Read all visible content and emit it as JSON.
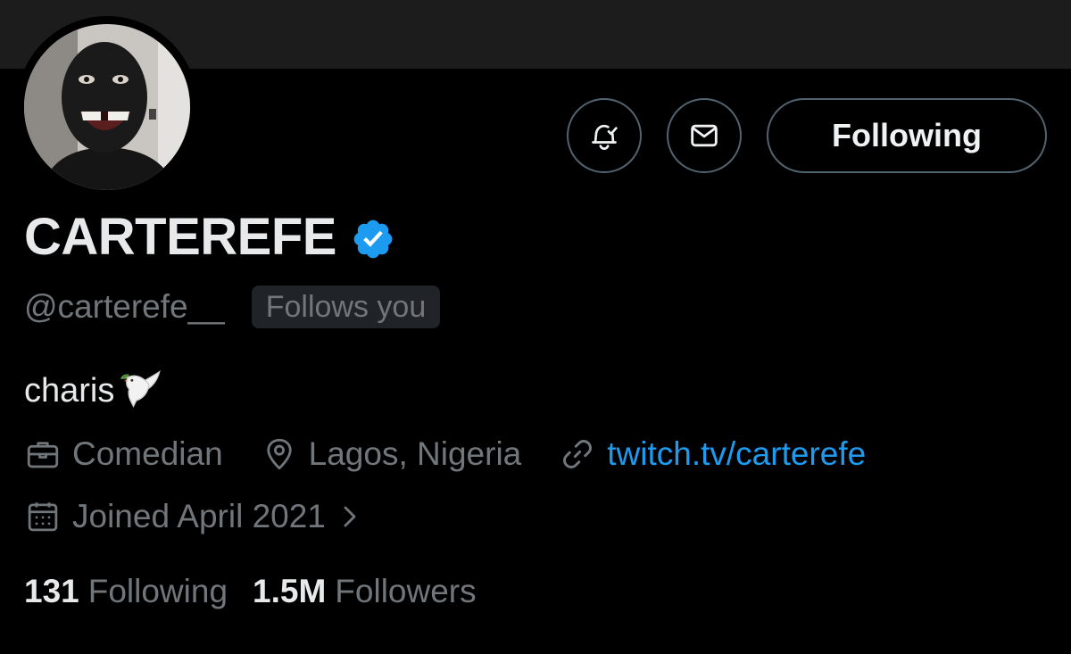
{
  "profile": {
    "display_name": "CARTEREFE",
    "handle": "@carterefe__",
    "follows_you_badge": "Follows you",
    "bio_text": "charis",
    "bio_emoji": "dove-with-olive-branch",
    "occupation": "Comedian",
    "location": "Lagos, Nigeria",
    "website": "twitch.tv/carterefe",
    "joined": "Joined April 2021",
    "verified": true
  },
  "actions": {
    "notify_icon": "bell-check-icon",
    "message_icon": "envelope-icon",
    "following_label": "Following"
  },
  "stats": {
    "following_count": "131",
    "following_label": "Following",
    "followers_count": "1.5M",
    "followers_label": "Followers"
  },
  "colors": {
    "background": "#000000",
    "banner": "#1c1c1d",
    "text_primary": "#e7e9ea",
    "text_secondary": "#71767b",
    "link": "#1d9bf0",
    "verified_badge": "#1d9bf0",
    "border": "#536471"
  }
}
